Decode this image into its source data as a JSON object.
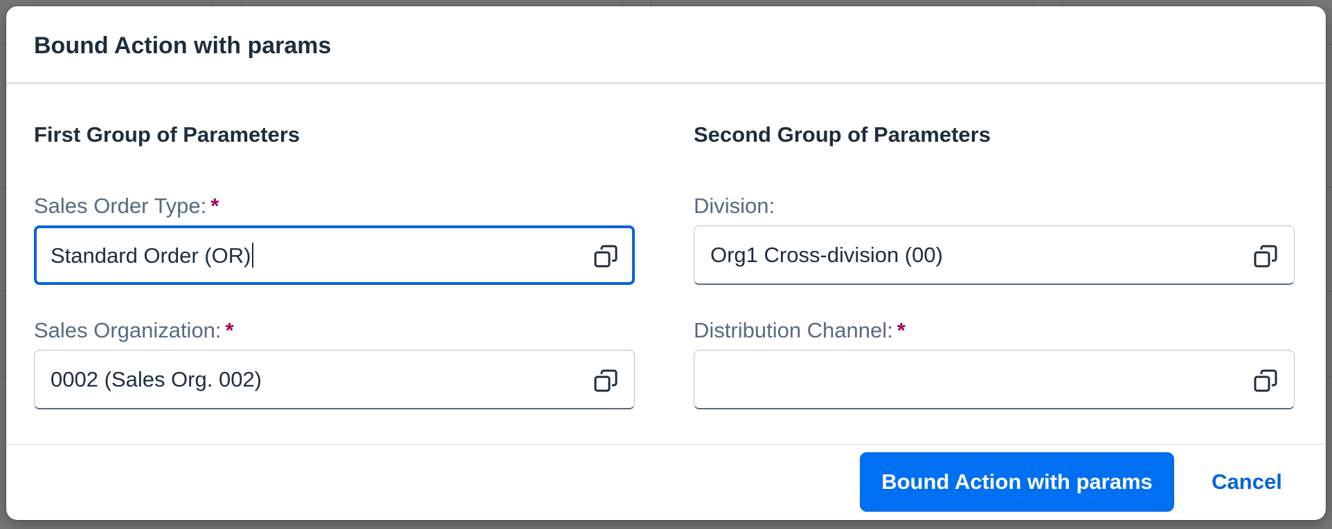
{
  "dialog": {
    "title": "Bound Action with params"
  },
  "groups": [
    {
      "title": "First Group of Parameters",
      "fields": [
        {
          "label": "Sales Order Type:",
          "required_mark": "*",
          "value": "Standard Order (OR)",
          "focused": true
        },
        {
          "label": "Sales Organization:",
          "required_mark": "*",
          "value": "0002 (Sales Org. 002)",
          "focused": false
        }
      ]
    },
    {
      "title": "Second Group of Parameters",
      "fields": [
        {
          "label": "Division:",
          "required_mark": "",
          "value": "Org1 Cross-division (00)",
          "focused": false
        },
        {
          "label": "Distribution Channel:",
          "required_mark": "*",
          "value": "",
          "focused": false
        }
      ]
    }
  ],
  "footer": {
    "primary_label": "Bound Action with params",
    "cancel_label": "Cancel"
  },
  "icons": {
    "value_help": "value-help-icon"
  },
  "colors": {
    "primary": "#0070f2",
    "required": "#a1005c",
    "focus_border": "#0064d9",
    "text": "#1d2d3e",
    "label": "#556b82"
  }
}
